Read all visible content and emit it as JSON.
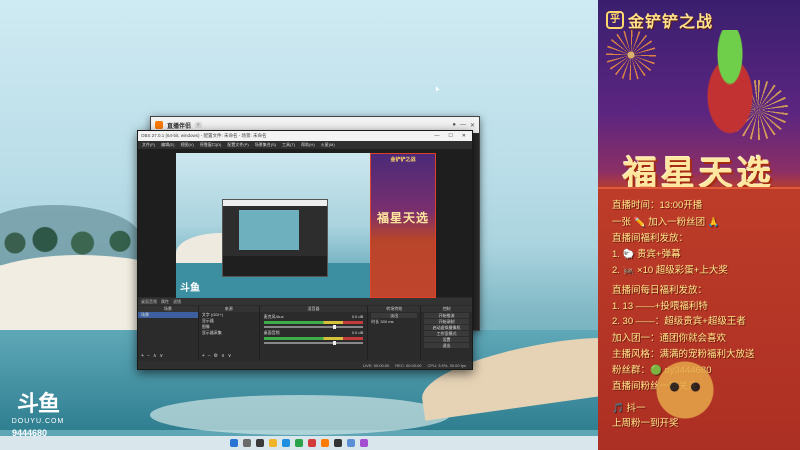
{
  "desktop": {
    "brand_mark": "斗鱼",
    "brand_word": "DOUYU.COM",
    "room_id": "9444680"
  },
  "back_window": {
    "app_name": "直播伴侣",
    "version": "v"
  },
  "obs": {
    "title": "OBS 27.0.1 (64-bit, windows) - 配置文件: 未命名 - 场景: 未命名",
    "menus": [
      "文件(F)",
      "编辑(E)",
      "视图(V)",
      "停靠窗口(D)",
      "配置文件(P)",
      "场景集合(S)",
      "工具(T)",
      "帮助(H)",
      "火星(M)"
    ],
    "preview_logo": "斗鱼",
    "overlay_title": "金铲铲之战",
    "overlay_big": "福星天选",
    "scene_dock_title": "场景",
    "scene_item": "场景",
    "sources_dock_title": "来源",
    "sources": [
      "文字 (GDI+)",
      "显示器",
      "图像",
      "显示器采集"
    ],
    "mixer_title": "混音器",
    "mixer_channels": [
      {
        "name": "麦克风/Aux",
        "db": "0.0 dB"
      },
      {
        "name": "桌面音频",
        "db": "0.0 dB"
      }
    ],
    "transition_title": "转场特效",
    "transition_value": "淡出",
    "duration_label": "时长",
    "duration_value": "300 ms",
    "controls_title": "控制",
    "controls": [
      "开始推流",
      "开始录制",
      "启动虚拟摄像机",
      "工作室模式",
      "设置",
      "退出"
    ],
    "status": [
      "LIVE: 00:00:00",
      "REC: 00:00:00",
      "CPU: 3.5%, 30.00 fps"
    ],
    "top_status": [
      "桌面音频",
      "属性",
      "滤镜"
    ]
  },
  "overlay": {
    "header_badge": "乎",
    "header_title": "金铲铲之战",
    "banner": "福星天选",
    "lines": [
      "直播时间：13:00开播",
      "一张 ✏️ 加入一粉丝团 🙏",
      "直播间福利发放：",
      "1. 🐑 贵宾+弹幕",
      "2. 🦗 ×10 超级彩蛋+上大奖",
      "直播间每日福利发放：",
      "1. 13 ——+投喂福利特",
      "2. 30 ——：超级贵宾+超级王者",
      "加入团一：通团你就会喜欢",
      "主播风格：满满的宠粉福利大放送",
      "粉丝群：🟢 dy3444680",
      "直播间粉丝一键关注",
      "🎵 抖一",
      "上周粉一到开奖"
    ]
  },
  "colors": {
    "overlay_gold": "#ffe38a",
    "overlay_red": "#c1432a",
    "obs_bg": "#2b2b2b",
    "accent_select": "#3d5fa0"
  }
}
